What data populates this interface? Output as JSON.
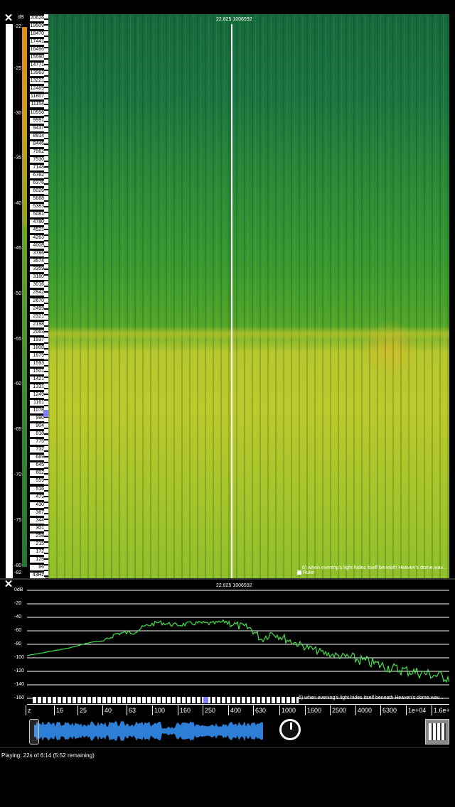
{
  "spectrogram": {
    "close_symbol": "✕",
    "db_unit": "dB",
    "db_labels": [
      "-22",
      "-25",
      "-30",
      "-35",
      "-40",
      "-45",
      "-50",
      "-55",
      "-60",
      "-65",
      "-70",
      "-75",
      "-80",
      "-82"
    ],
    "freq_labels": [
      "20626",
      "19509",
      "18470",
      "17441",
      "16496",
      "15590",
      "14771",
      "13963",
      "13221",
      "12489",
      "11807",
      "11154",
      "10558",
      "9991",
      "9437",
      "8914",
      "8446",
      "7962",
      "7530",
      "7148",
      "6782",
      "6376",
      "6026",
      "5688",
      "5383",
      "5081",
      "4780",
      "4521",
      "4263",
      "4008",
      "3786",
      "3574",
      "3359",
      "3180",
      "3016",
      "2842",
      "2670",
      "2499",
      "2321",
      "2198",
      "2063",
      "1937",
      "1808",
      "1679",
      "1593",
      "1501",
      "1421",
      "1331",
      "1249",
      "1161",
      "1078",
      "990",
      "904",
      "818",
      "775",
      "732",
      "689",
      "645",
      "602",
      "559",
      "516",
      "473",
      "430",
      "387",
      "344",
      "301",
      "258",
      "215",
      "172",
      "129",
      "86",
      "43Hz"
    ],
    "cursor_readout": "22.825  1006592",
    "track_title": "6) when evening's light hides itself beneath Heaven's dome.wav...",
    "ruler_label": "Ruler",
    "colors": {
      "dark": "#1a6e3e",
      "mid": "#3f9a2c",
      "bright": "#b8cd2a",
      "peak": "#e0a023"
    }
  },
  "spectrum": {
    "close_symbol": "✕",
    "cursor_readout": "22.825  1006592",
    "y_labels": [
      "0dB",
      "-20",
      "-40",
      "-60",
      "-80",
      "-100",
      "-120",
      "-140",
      "-160"
    ],
    "x_labels": [
      "z",
      "16",
      "25",
      "40",
      "63",
      "100",
      "160",
      "250",
      "400",
      "630",
      "1000",
      "1600",
      "2500",
      "4000",
      "6300",
      "1e+04",
      "1.6e+"
    ],
    "track_title": "6) when evening's light hides itself beneath Heaven's dome.wav...",
    "line_color": "#45e34a"
  },
  "transport": {
    "status": "Playing: 22s of 6:14 (5:52 remaining)",
    "waveform_color": "#2c7ed6"
  }
}
